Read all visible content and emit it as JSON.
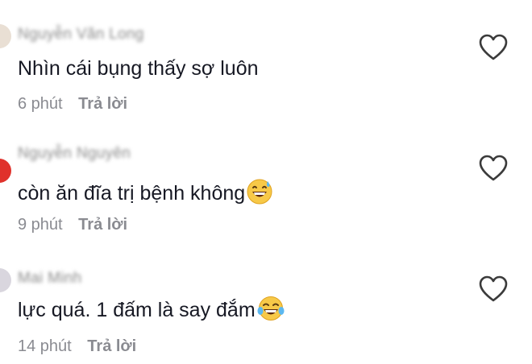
{
  "comments": [
    {
      "username": "Nguyễn Văn Long",
      "text": "Nhìn cái bụng thấy sợ luôn",
      "emoji": "",
      "time": "6 phút",
      "reply_label": "Trả lời"
    },
    {
      "username": "Nguyễn Nguyên",
      "text": "còn ăn đĩa trị bệnh không",
      "emoji": "grinning-sweat-emoji",
      "time": "9 phút",
      "reply_label": "Trả lời"
    },
    {
      "username": "Mai Minh",
      "text": "lực quá. 1 đấm là say đắm",
      "emoji": "tears-of-joy-emoji",
      "time": "14 phút",
      "reply_label": "Trả lời"
    }
  ],
  "icons": {
    "like": "heart-outline-icon"
  },
  "colors": {
    "text": "#161823",
    "secondary": "#8a8b91"
  }
}
